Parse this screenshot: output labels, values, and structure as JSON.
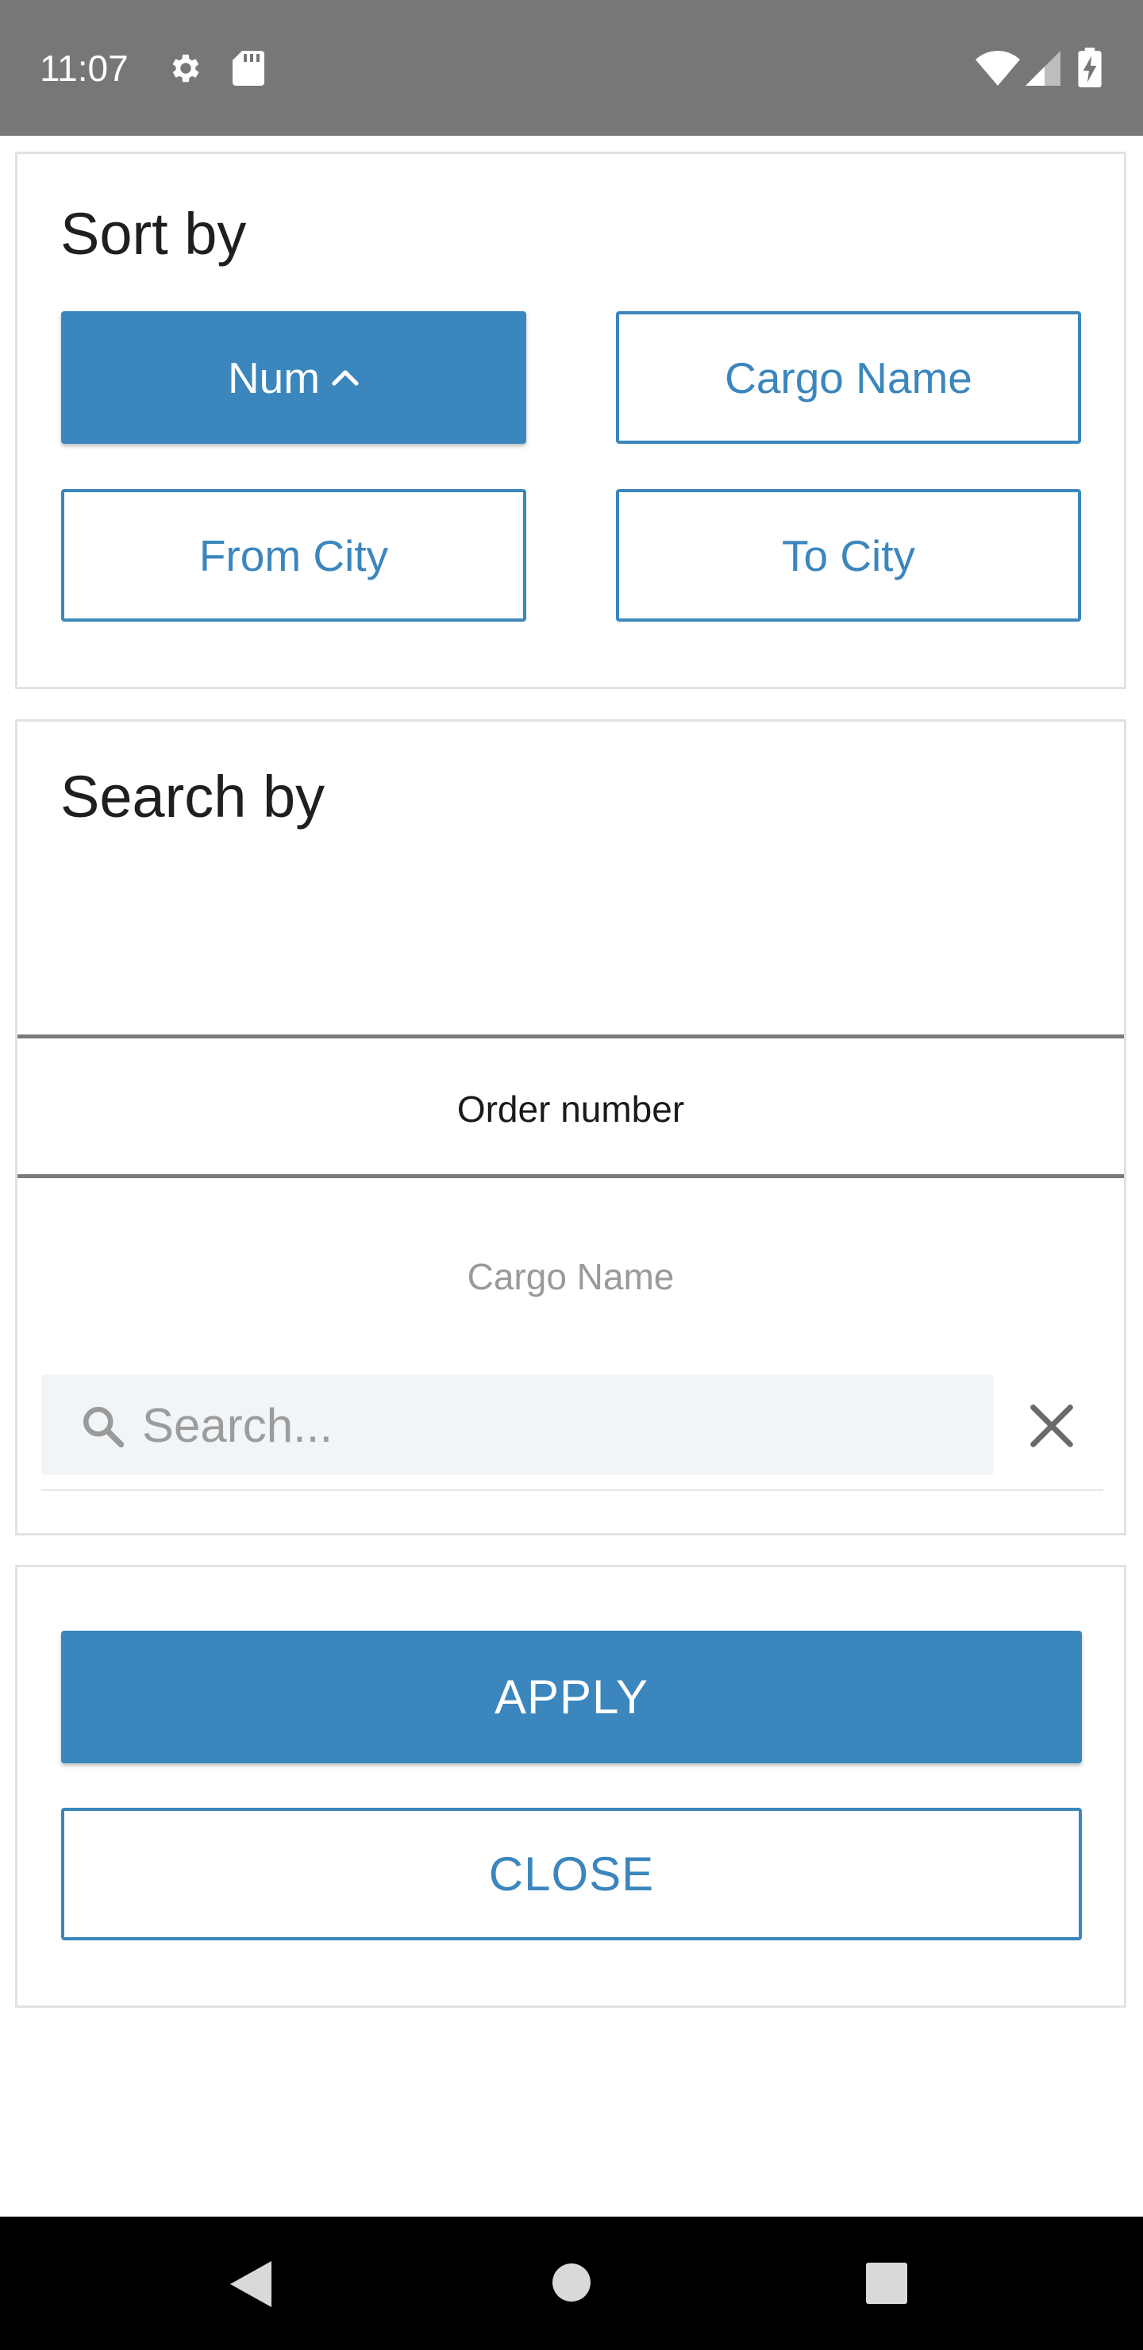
{
  "status_bar": {
    "time": "11:07",
    "icons": [
      "gear-icon",
      "sd-card-icon",
      "wifi-icon",
      "cell-signal-icon",
      "battery-charging-icon"
    ]
  },
  "sort": {
    "title": "Sort by",
    "options": [
      {
        "label": "Num",
        "active": true,
        "direction_icon": "chevron-up-icon"
      },
      {
        "label": "Cargo Name",
        "active": false
      },
      {
        "label": "From City",
        "active": false
      },
      {
        "label": "To City",
        "active": false
      }
    ]
  },
  "search": {
    "title": "Search by",
    "fields": [
      {
        "label": "Order number",
        "selected": true
      },
      {
        "label": "Cargo Name",
        "selected": false
      }
    ],
    "input": {
      "placeholder": "Search...",
      "value": ""
    }
  },
  "actions": {
    "apply_label": "APPLY",
    "close_label": "CLOSE"
  },
  "colors": {
    "accent": "#3b86bd",
    "status_bar": "#777777",
    "nav_bar": "#000000",
    "search_bg": "#f1f5f8"
  }
}
